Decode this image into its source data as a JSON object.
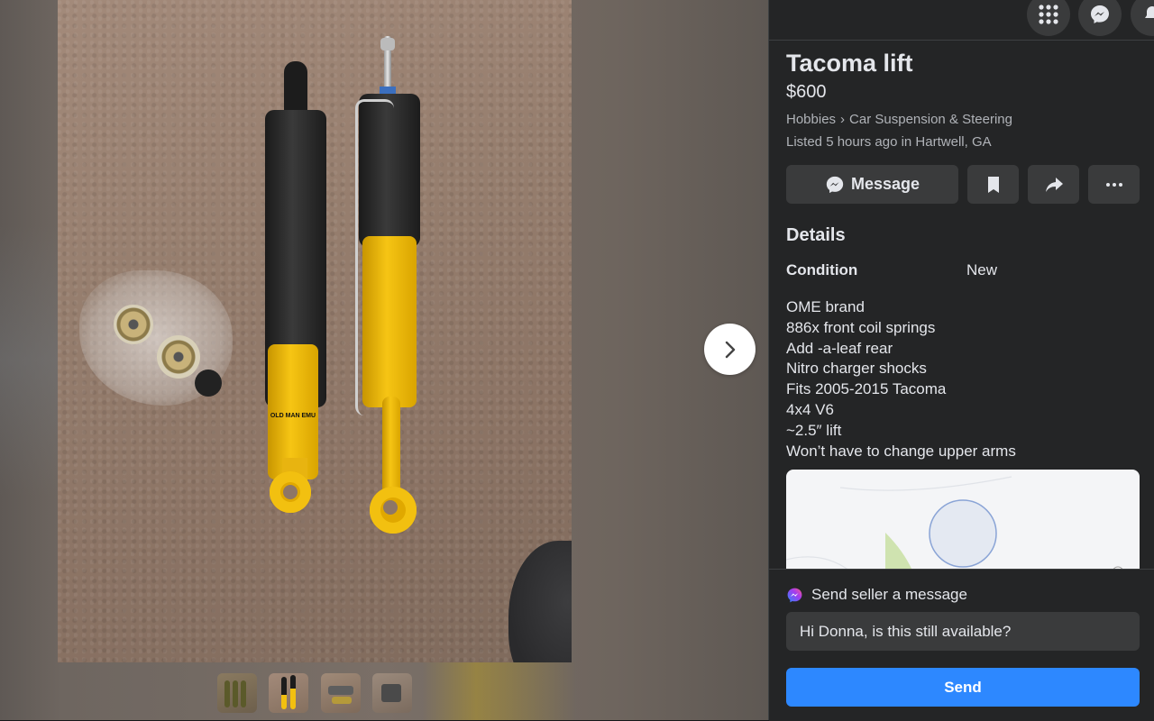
{
  "listing": {
    "title": "Tacoma lift",
    "price": "$600",
    "breadcrumb": [
      "Hobbies",
      "Car Suspension & Steering"
    ],
    "breadcrumb_separator": "›",
    "listed": "Listed 5 hours ago in Hartwell, GA"
  },
  "actions": {
    "message_label": "Message",
    "save_icon": "bookmark-icon",
    "share_icon": "share-icon",
    "more_icon": "more-icon"
  },
  "details": {
    "heading": "Details",
    "condition_label": "Condition",
    "condition_value": "New",
    "description": [
      "OME brand",
      "886x front coil springs",
      "Add -a-leaf rear",
      "Nitro charger shocks",
      "Fits 2005-2015 Tacoma",
      "4x4 V6",
      "~2.5″ lift",
      "Won’t have to change upper arms"
    ]
  },
  "photo": {
    "shock_label": "OLD MAN EMU"
  },
  "gallery": {
    "thumbnail_count": 4,
    "active_index": 1
  },
  "top_icons": [
    "menu-grid-icon",
    "messenger-icon",
    "notifications-icon"
  ],
  "message_box": {
    "label": "Send seller a message",
    "input_value": "Hi Donna, is this still available?",
    "send_label": "Send"
  },
  "colors": {
    "panel_bg": "#242526",
    "text_primary": "#e4e6eb",
    "text_secondary": "#b0b3b8",
    "button_bg": "#3a3b3c",
    "accent": "#2d88ff"
  }
}
